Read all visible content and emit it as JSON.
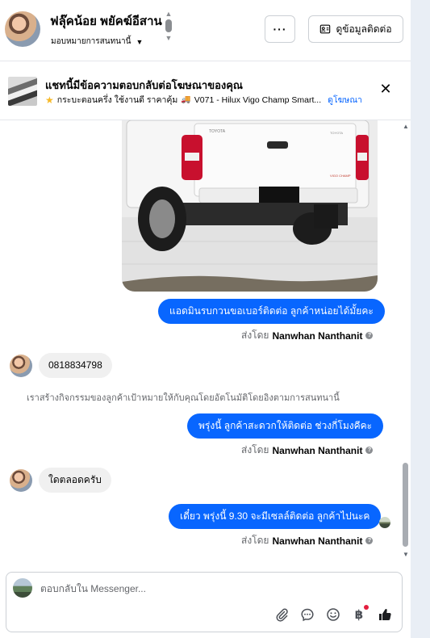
{
  "header": {
    "name": "ฟลุ๊คน้อย พยัคฆ์อีสาน",
    "assign_label": "มอบหมายการสนทนานี้",
    "more_label": "···",
    "contact_label": "ดูข้อมูลติดต่อ"
  },
  "ad_banner": {
    "title": "แชทนี้มีข้อความตอบกลับต่อโฆษณาของคุณ",
    "description": "กระบะตอนครึ่ง ใช้งานดี ราคาคุ้ม",
    "ad_name": "V071 - Hilux Vigo Champ Smart...",
    "link_label": "ดูโฆษณา",
    "close_label": "✕"
  },
  "messages": [
    {
      "type": "outgoing",
      "text": "แอดมินรบกวนขอเบอร์ติดต่อ ลูกค้าหน่อยได้มั้ยคะ",
      "sent_by_prefix": "ส่งโดย",
      "sender": "Nanwhan Nanthanit"
    },
    {
      "type": "incoming",
      "text": "0818834798"
    },
    {
      "type": "system",
      "text": "เราสร้างกิจกรรมของลูกค้าเป้าหมายให้กับคุณโดยอัตโนมัติโดยอิงตามการสนทนานี้"
    },
    {
      "type": "outgoing",
      "text": "พรุ่งนี้ ลูกค้าสะดวกให้ติดต่อ ช่วงกี่โมงคีคะ",
      "sent_by_prefix": "ส่งโดย",
      "sender": "Nanwhan Nanthanit"
    },
    {
      "type": "incoming",
      "text": "ใดตลอดครับ"
    },
    {
      "type": "outgoing",
      "text": "เดี๋ยว พรุ่งนี้  9.30 จะมีเซลล์ติดต่อ ลูกค้าไปนะค",
      "sent_by_prefix": "ส่งโดย",
      "sender": "Nanwhan Nanthanit"
    }
  ],
  "photo": {
    "badge_text": "TOYOTA",
    "tailgate_text": "TOYOTA",
    "model_badge": "VIGO CHAMP"
  },
  "composer": {
    "placeholder": "ตอบกลับใน Messenger...",
    "baht_symbol": "฿"
  },
  "colors": {
    "accent": "#0866ff",
    "incoming_bubble": "#f0f0f0",
    "notification_dot": "#e41e3f"
  }
}
